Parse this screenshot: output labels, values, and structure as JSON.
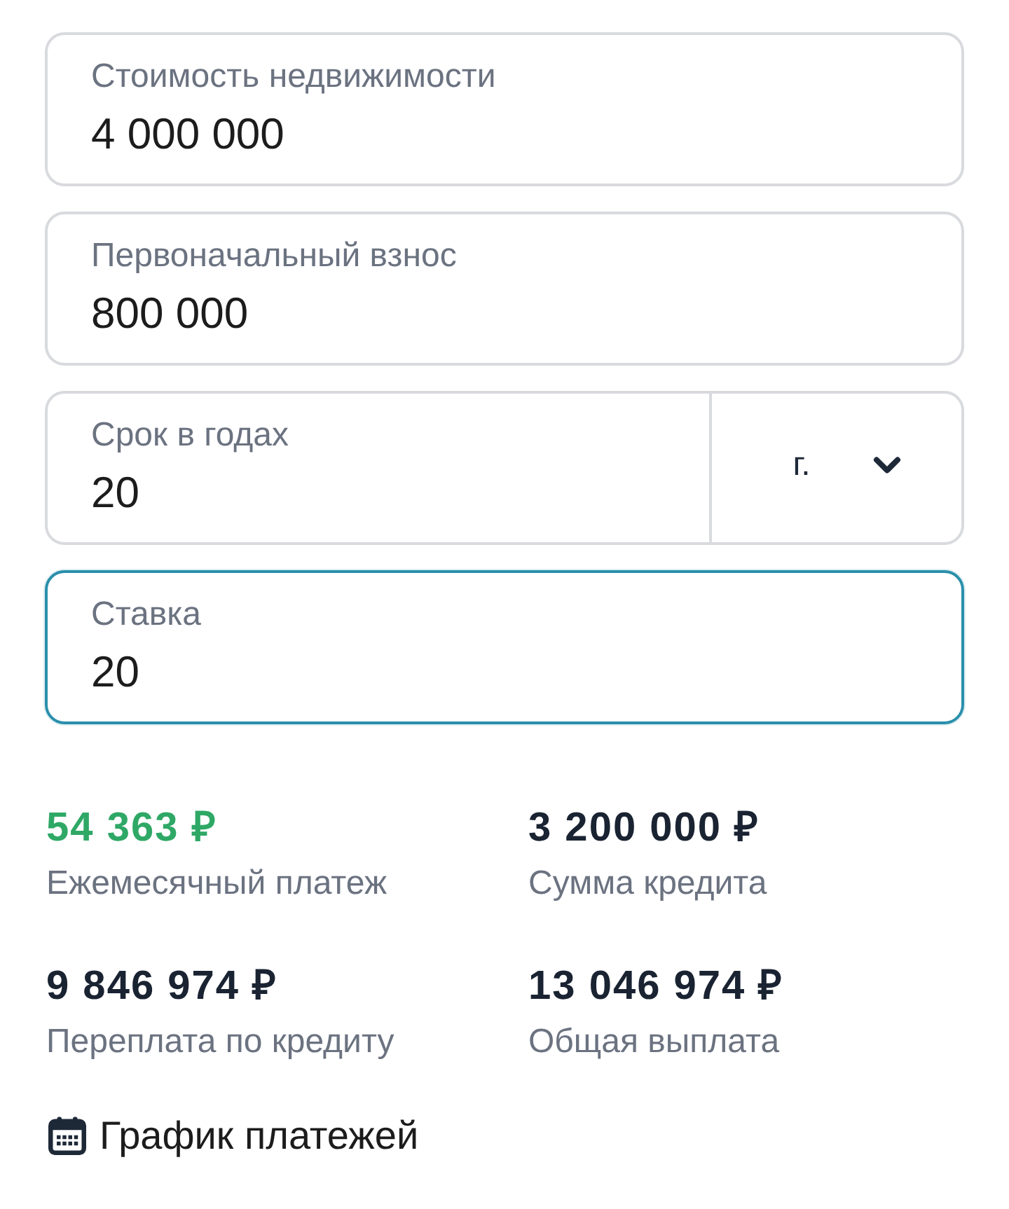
{
  "fields": [
    {
      "kind": "text",
      "label": "Стоимость недвижимости",
      "value": "4 000 000",
      "focused": false
    },
    {
      "kind": "text",
      "label": "Первоначальный взнос",
      "value": "800 000",
      "focused": false
    },
    {
      "kind": "select",
      "label": "Срок в годах",
      "value": "20",
      "unit": "г.",
      "focused": false
    },
    {
      "kind": "text",
      "label": "Ставка",
      "value": "20",
      "focused": true
    }
  ],
  "results": [
    {
      "value": "54 363 ₽",
      "label": "Ежемесячный платеж",
      "highlighted": true
    },
    {
      "value": "3 200 000 ₽",
      "label": "Сумма кредита",
      "highlighted": false
    },
    {
      "value": "9 846 974 ₽",
      "label": "Переплата по кредиту",
      "highlighted": false
    },
    {
      "value": "13 046 974 ₽",
      "label": "Общая выплата",
      "highlighted": false
    }
  ],
  "schedule_link": {
    "label": "График платежей"
  }
}
